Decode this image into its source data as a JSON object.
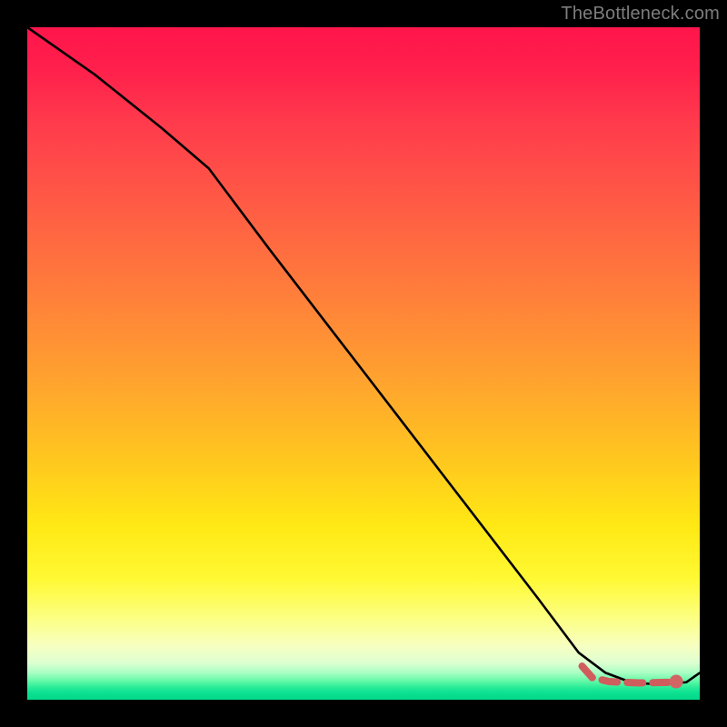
{
  "attribution": "TheBottleneck.com",
  "colors": {
    "curve_stroke": "#000000",
    "dashed_stroke": "#cf5d5d",
    "dot_fill": "#d26464",
    "background_black": "#000000"
  },
  "chart_data": {
    "type": "line",
    "title": "",
    "xlabel": "",
    "ylabel": "",
    "xlim": [
      0,
      100
    ],
    "ylim": [
      0,
      100
    ],
    "series": [
      {
        "name": "bottleneck-curve",
        "style": "solid",
        "x": [
          0,
          10,
          20,
          27,
          36,
          46,
          56,
          66,
          76,
          82,
          86,
          90,
          94,
          98,
          100
        ],
        "y": [
          100,
          93,
          85,
          79,
          67,
          54,
          41,
          28,
          15,
          7,
          4,
          2.5,
          2.3,
          2.6,
          4
        ]
      },
      {
        "name": "optimal-range-dashed",
        "style": "dashed",
        "x": [
          82.5,
          84,
          86.5,
          88.5,
          91,
          93.5,
          96
        ],
        "y": [
          5.0,
          3.3,
          2.7,
          2.6,
          2.5,
          2.55,
          2.6
        ]
      }
    ],
    "marker": {
      "name": "optimal-point",
      "x": 96.5,
      "y": 2.7
    },
    "background_gradient": {
      "direction": "vertical",
      "stops": [
        {
          "pos": 0.0,
          "color": "#ff154b"
        },
        {
          "pos": 0.3,
          "color": "#ff6a3f"
        },
        {
          "pos": 0.6,
          "color": "#ffc420"
        },
        {
          "pos": 0.82,
          "color": "#fff933"
        },
        {
          "pos": 0.92,
          "color": "#f7ffc1"
        },
        {
          "pos": 0.97,
          "color": "#5df8a5"
        },
        {
          "pos": 1.0,
          "color": "#04d98a"
        }
      ]
    }
  }
}
